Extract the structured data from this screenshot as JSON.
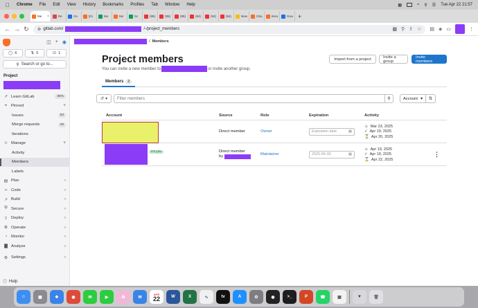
{
  "menubar": {
    "app_name": "Chrome",
    "items": [
      "File",
      "Edit",
      "View",
      "History",
      "Bookmarks",
      "Profiles",
      "Tab",
      "Window",
      "Help"
    ],
    "clock": "Tue Apr 22  21:57"
  },
  "tabs": [
    {
      "label": "Me",
      "color": "#fc6d26",
      "active": true
    },
    {
      "label": "Re",
      "color": "#d44"
    },
    {
      "label": "Go",
      "color": "#1a73e8"
    },
    {
      "label": "[Gi",
      "color": "#fc6d26"
    },
    {
      "label": "Mo",
      "color": "#0f9d58"
    },
    {
      "label": "Mo",
      "color": "#fc6d26"
    },
    {
      "label": "Sc",
      "color": "#0f9d58"
    },
    {
      "label": "(95) Yo",
      "color": "#e33"
    },
    {
      "label": "(95) H",
      "color": "#e33"
    },
    {
      "label": "(95) H",
      "color": "#e33"
    },
    {
      "label": "(94) H",
      "color": "#e33"
    },
    {
      "label": "(94) H",
      "color": "#e33"
    },
    {
      "label": "(94) H",
      "color": "#e33"
    },
    {
      "label": "New ta",
      "color": "#fbbc04"
    },
    {
      "label": "GitLab",
      "color": "#fc6d26"
    },
    {
      "label": "Iteratio",
      "color": "#fc6d26"
    },
    {
      "label": "Googl",
      "color": "#1a73e8"
    }
  ],
  "address": {
    "prefix": "gitlab.com/",
    "suffix": "/-/project_members"
  },
  "sidebar": {
    "counters": [
      {
        "icon": "issues-icon",
        "value": "6"
      },
      {
        "icon": "merge-request-icon",
        "value": "0"
      },
      {
        "icon": "todo-icon",
        "value": "1"
      }
    ],
    "search_label": "Search or go to...",
    "section_title": "Project",
    "items": [
      {
        "label": "Learn GitLab",
        "badge": "38%",
        "type": "item",
        "icon": "rocket-icon"
      },
      {
        "label": "Pinned",
        "type": "group",
        "icon": "pin-icon"
      },
      {
        "label": "Issues",
        "badge": "53",
        "type": "sub"
      },
      {
        "label": "Merge requests",
        "badge": "29",
        "type": "sub"
      },
      {
        "label": "Iterations",
        "type": "sub"
      },
      {
        "label": "Manage",
        "type": "group",
        "icon": "users-icon"
      },
      {
        "label": "Activity",
        "type": "sub"
      },
      {
        "label": "Members",
        "type": "sub",
        "active": true
      },
      {
        "label": "Labels",
        "type": "sub"
      },
      {
        "label": "Plan",
        "type": "chev",
        "icon": "plan-icon"
      },
      {
        "label": "Code",
        "type": "chev",
        "icon": "code-icon"
      },
      {
        "label": "Build",
        "type": "chev",
        "icon": "rocket-icon"
      },
      {
        "label": "Secure",
        "type": "chev",
        "icon": "shield-icon"
      },
      {
        "label": "Deploy",
        "type": "chev",
        "icon": "deploy-icon"
      },
      {
        "label": "Operate",
        "type": "chev",
        "icon": "operate-icon"
      },
      {
        "label": "Monitor",
        "type": "chev",
        "icon": "monitor-icon"
      },
      {
        "label": "Analyze",
        "type": "chev",
        "icon": "chart-icon"
      },
      {
        "label": "Settings",
        "type": "chev",
        "icon": "gear-icon"
      }
    ],
    "help_label": "Help"
  },
  "main": {
    "breadcrumb_current": "Members",
    "title": "Project members",
    "subtitle_before": "You can invite a new member to",
    "subtitle_after": "or invite another group.",
    "buttons": {
      "import": "Import from a project",
      "invite_group": "Invite a group",
      "invite_members": "Invite members"
    },
    "tab_label": "Members",
    "tab_count": "2",
    "filter_placeholder": "Filter members",
    "sort_label": "Account",
    "columns": {
      "account": "Account",
      "source": "Source",
      "role": "Role",
      "expiration": "Expiration",
      "activity": "Activity"
    },
    "members": [
      {
        "source": "Direct member",
        "role": "Owner",
        "expiration": "Expiration date",
        "activity": [
          "Mar 23, 2025",
          "Apr 19, 2025",
          "Apr 20, 2025"
        ]
      },
      {
        "source_line1": "Direct member",
        "source_line2": "by",
        "role": "Maintainer",
        "expiration": "2025-06-30",
        "its_you": "It's you",
        "activity": [
          "Apr 19, 2025",
          "Apr 19, 2025",
          "Apr 22, 2025"
        ]
      }
    ]
  },
  "dock": {
    "calendar_month": "APR",
    "calendar_day": "22"
  }
}
